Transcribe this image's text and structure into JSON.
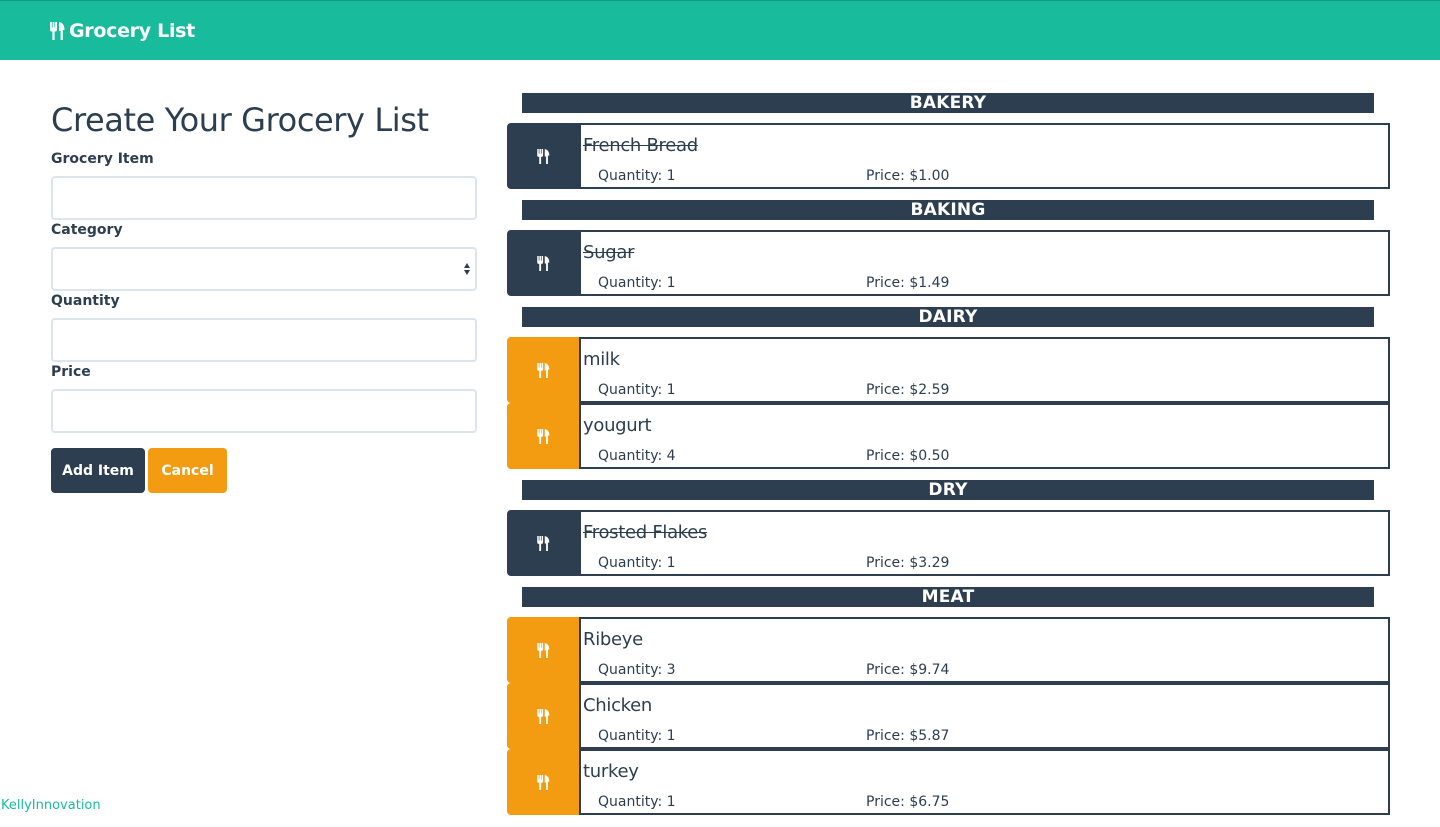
{
  "navbar": {
    "brand_icon": "cutlery-icon",
    "brand_label": "Grocery List",
    "background": "#18bc9c"
  },
  "form": {
    "title": "Create Your Grocery List",
    "fields": {
      "item_label": "Grocery Item",
      "item_value": "",
      "category_label": "Category",
      "category_value": "",
      "quantity_label": "Quantity",
      "quantity_value": "",
      "price_label": "Price",
      "price_value": ""
    },
    "buttons": {
      "add_label": "Add Item",
      "cancel_label": "Cancel"
    }
  },
  "list": {
    "categories": [
      {
        "name": "BAKERY",
        "items": [
          {
            "name": "French Bread",
            "quantity": "Quantity: 1",
            "price": "Price: $1.00",
            "purchased": true
          }
        ]
      },
      {
        "name": "BAKING",
        "items": [
          {
            "name": "Sugar",
            "quantity": "Quantity: 1",
            "price": "Price: $1.49",
            "purchased": true
          }
        ]
      },
      {
        "name": "DAIRY",
        "items": [
          {
            "name": "milk",
            "quantity": "Quantity: 1",
            "price": "Price: $2.59",
            "purchased": false
          },
          {
            "name": "yougurt",
            "quantity": "Quantity: 4",
            "price": "Price: $0.50",
            "purchased": false
          }
        ]
      },
      {
        "name": "DRY",
        "items": [
          {
            "name": "Frosted Flakes",
            "quantity": "Quantity: 1",
            "price": "Price: $3.29",
            "purchased": true
          }
        ]
      },
      {
        "name": "MEAT",
        "items": [
          {
            "name": "Ribeye",
            "quantity": "Quantity: 3",
            "price": "Price: $9.74",
            "purchased": false
          },
          {
            "name": "Chicken",
            "quantity": "Quantity: 1",
            "price": "Price: $5.87",
            "purchased": false
          },
          {
            "name": "turkey",
            "quantity": "Quantity: 1",
            "price": "Price: $6.75",
            "purchased": false
          }
        ]
      }
    ],
    "colors": {
      "purchased": "#2c3e50",
      "pending": "#f39c12"
    }
  },
  "footer": {
    "credit": "KellyInnovation"
  }
}
